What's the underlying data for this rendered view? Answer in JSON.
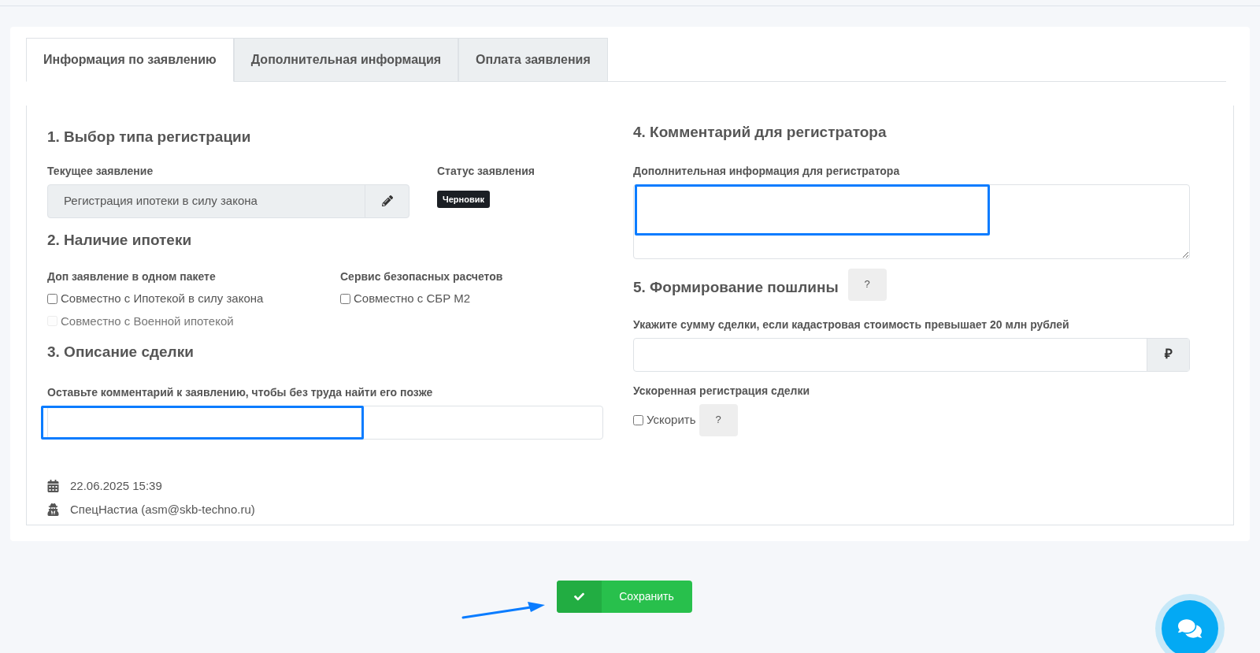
{
  "tabs": [
    {
      "label": "Информация по заявлению",
      "selected": true
    },
    {
      "label": "Дополнительная информация",
      "selected": false
    },
    {
      "label": "Оплата заявления",
      "selected": false
    }
  ],
  "section1": {
    "title": "1. Выбор типа регистрации",
    "current_label": "Текущее заявление",
    "current_value": "Регистрация ипотеки в силу закона",
    "status_label": "Статус заявления",
    "status_badge": "Черновик"
  },
  "section2": {
    "title": "2. Наличие ипотеки",
    "groups": [
      {
        "title": "Доп заявление в одном пакете",
        "options": [
          {
            "label": "Совместно с Ипотекой в силу закона",
            "checked": false,
            "disabled": false
          },
          {
            "label": "Совместно с Военной ипотекой",
            "checked": false,
            "disabled": true
          }
        ]
      },
      {
        "title": "Сервис безопасных расчетов",
        "options": [
          {
            "label": "Совместно с СБР М2",
            "checked": false,
            "disabled": false
          }
        ]
      }
    ]
  },
  "section3": {
    "title": "3. Описание сделки",
    "field_label": "Оставьте комментарий к заявлению, чтобы без труда найти его позже"
  },
  "meta": {
    "date": "22.06.2025 15:39",
    "author": "СпецНастиа (asm@skb-techno.ru)"
  },
  "section4": {
    "title": "4. Комментарий для регистратора",
    "field_label": "Дополнительная информация для регистратора"
  },
  "section5": {
    "title": "5. Формирование пошлины",
    "help": "?",
    "amount_label": "Укажите сумму сделки, если кадастровая стоимость превышает 20 млн рублей",
    "currency": "₽",
    "speed_label": "Ускоренная регистрация сделки",
    "speed_option": {
      "label": "Ускорить",
      "checked": false
    },
    "speed_help": "?"
  },
  "save_button": "Сохранить"
}
